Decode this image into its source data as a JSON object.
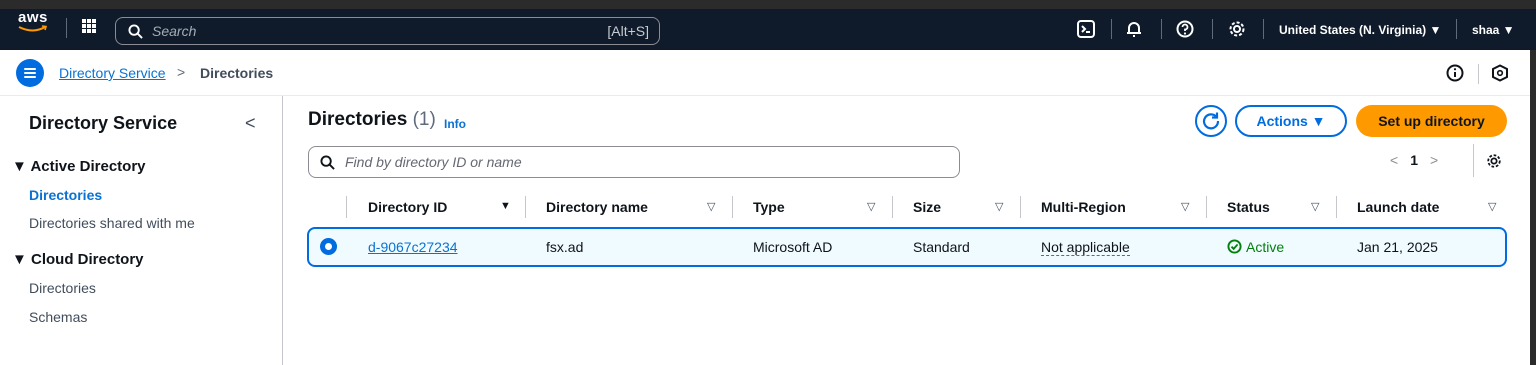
{
  "topnav": {
    "logo": "aws",
    "search_placeholder": "Search",
    "search_shortcut": "[Alt+S]",
    "region": "United States (N. Virginia) ▼",
    "user": "shaa ▼"
  },
  "breadcrumb": {
    "parent": "Directory Service",
    "separator": ">",
    "current": "Directories"
  },
  "sidenav": {
    "title": "Directory Service",
    "collapse": "<",
    "sections": [
      {
        "label": "▼ Active Directory",
        "items": [
          "Directories",
          "Directories shared with me"
        ]
      },
      {
        "label": "▼ Cloud Directory",
        "items": [
          "Directories",
          "Schemas"
        ]
      }
    ]
  },
  "main": {
    "heading": "Directories",
    "count": "(1)",
    "info": "Info",
    "actions_label": "Actions ▼",
    "setup_label": "Set up directory",
    "filter_placeholder": "Find by directory ID or name",
    "pagination": {
      "prev": "<",
      "page": "1",
      "next": ">"
    }
  },
  "table": {
    "columns": [
      "Directory ID",
      "Directory name",
      "Type",
      "Size",
      "Multi-Region",
      "Status",
      "Launch date"
    ],
    "rows": [
      {
        "id": "d-9067c27234",
        "name": "fsx.ad",
        "type": "Microsoft AD",
        "size": "Standard",
        "multi_region": "Not applicable",
        "status": "Active",
        "launch": "Jan 21, 2025"
      }
    ]
  },
  "colors": {
    "accent": "#006ce0",
    "primary_button": "#ff9900",
    "nav_bg": "#0f1b2a",
    "status_ok": "#037f0c"
  }
}
